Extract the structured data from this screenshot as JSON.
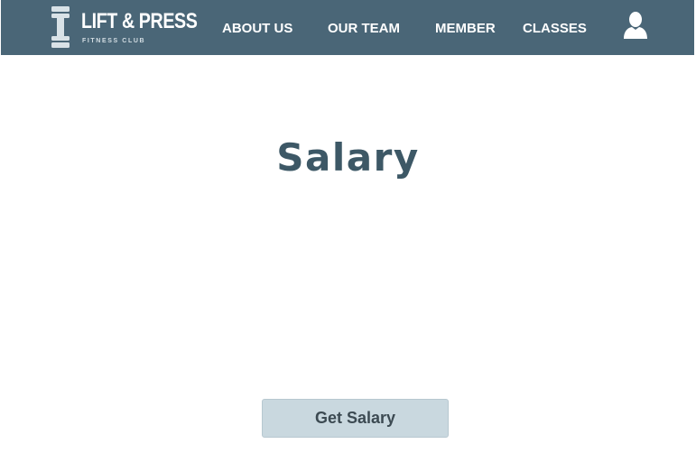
{
  "brand": {
    "name": "LIFT & PRESS",
    "tagline": "FITNESS CLUB",
    "logo_icon": "dumbbell-icon"
  },
  "nav": {
    "items": [
      {
        "label": "ABOUT US"
      },
      {
        "label": "OUR TEAM"
      },
      {
        "label": "MEMBER"
      },
      {
        "label": "CLASSES"
      }
    ],
    "user_icon": "user-icon"
  },
  "main": {
    "title": "Salary",
    "button_label": "Get Salary"
  },
  "colors": {
    "navbar": "#4a6677",
    "title": "#3d5866",
    "button_bg": "#c9d8df",
    "button_text": "#3c4a52"
  }
}
